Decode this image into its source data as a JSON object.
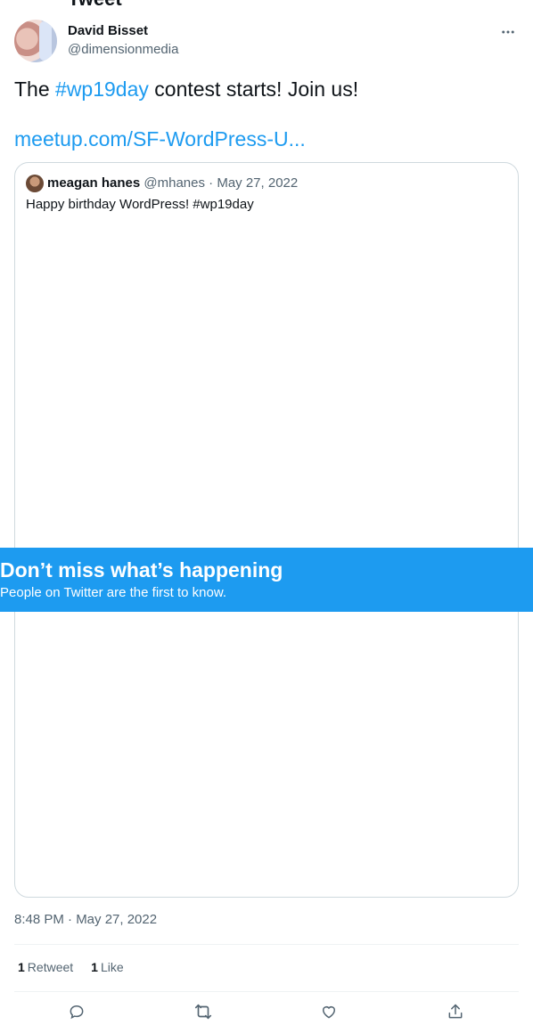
{
  "page": {
    "cut_title": "Tweet"
  },
  "author": {
    "name": "David Bisset",
    "handle": "@dimensionmedia"
  },
  "tweet": {
    "text_before": "The ",
    "hashtag": "#wp19day",
    "text_after": " contest starts! Join us!",
    "link": "meetup.com/SF-WordPress-U..."
  },
  "quoted": {
    "name": "meagan hanes",
    "handle": "@mhanes",
    "separator": " · ",
    "date": "May 27, 2022",
    "text": "Happy birthday WordPress! #wp19day"
  },
  "banner": {
    "title": "Don’t miss what’s happening",
    "subtitle": "People on Twitter are the first to know."
  },
  "meta": {
    "timestamp": "8:48 PM · May 27, 2022"
  },
  "stats": {
    "retweets_count": "1",
    "retweets_label": "Retweet",
    "likes_count": "1",
    "likes_label": "Like"
  },
  "icons": {
    "more": "more-horizontal-icon",
    "reply": "reply-icon",
    "retweet": "retweet-icon",
    "like": "heart-icon",
    "share": "share-icon"
  },
  "colors": {
    "accent": "#1d9bf0",
    "text": "#0f1419",
    "muted": "#536471",
    "border": "#cfd9de"
  }
}
